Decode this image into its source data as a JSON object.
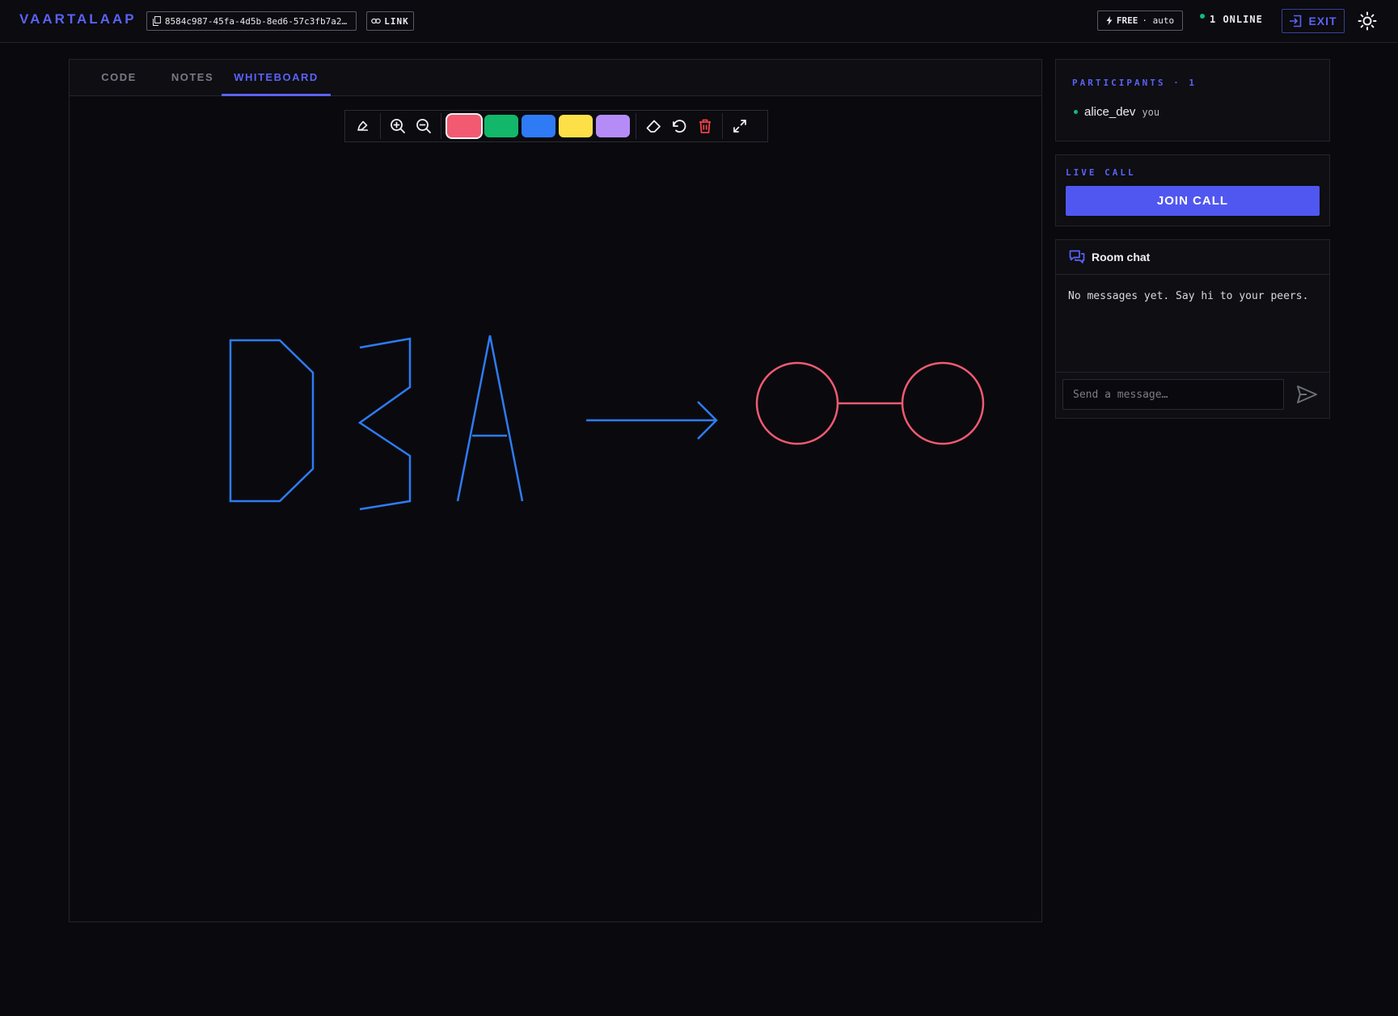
{
  "header": {
    "logo": "VAARTALAAP",
    "room_id": "8584c987-45fa-4d5b-8ed6-57c3fb7a20…",
    "link_label": "LINK",
    "plan_label": "FREE",
    "plan_mode": "· auto",
    "online_label": "1 ONLINE",
    "exit_label": "EXIT"
  },
  "tabs": [
    {
      "label": "CODE"
    },
    {
      "label": "NOTES"
    },
    {
      "label": "WHITEBOARD",
      "active": true
    }
  ],
  "toolbar": {
    "colors": [
      "#f25a72",
      "#12b76a",
      "#2f7bf5",
      "#fde047",
      "#b58cf7"
    ],
    "selected_color": "#f25a72",
    "icons": [
      "pen-icon",
      "zoom-in-icon",
      "zoom-out-icon",
      "eraser-icon",
      "undo-icon",
      "trash-icon",
      "fullscreen-icon"
    ]
  },
  "whiteboard": {
    "strokes": [
      {
        "shape": "letter-D",
        "color": "#2f7bf5"
      },
      {
        "shape": "letter-3-like",
        "color": "#2f7bf5"
      },
      {
        "shape": "letter-A",
        "color": "#2f7bf5"
      },
      {
        "shape": "arrow",
        "color": "#2f7bf5"
      },
      {
        "shape": "circle-line-circle",
        "color": "#f25a72"
      }
    ]
  },
  "participants": {
    "title": "PARTICIPANTS · 1",
    "list": [
      {
        "name": "alice_dev",
        "tag": "you"
      }
    ]
  },
  "call": {
    "title": "LIVE CALL",
    "button": "JOIN CALL"
  },
  "chat": {
    "title": "Room chat",
    "empty": "No messages yet. Say hi to your peers.",
    "placeholder": "Send a message…"
  },
  "colors": {
    "accent": "#5b62f5",
    "online": "#10b981",
    "background": "#0a0a0e"
  }
}
